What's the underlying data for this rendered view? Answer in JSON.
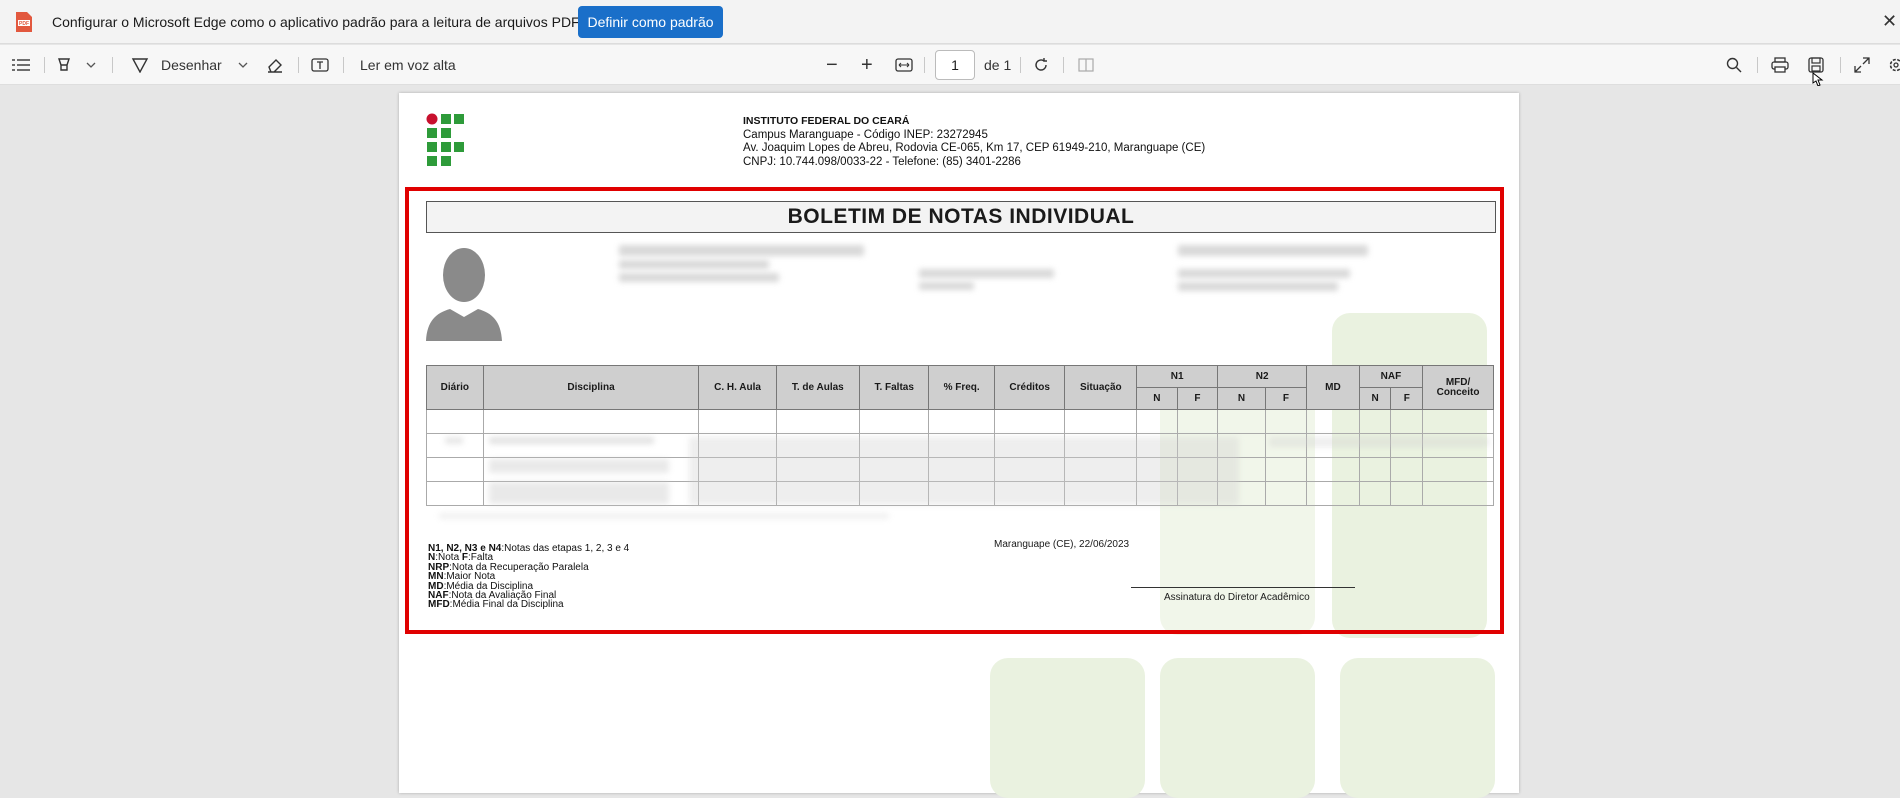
{
  "notification": {
    "message": "Configurar o Microsoft Edge como o aplicativo padrão para a leitura de arquivos PDF?",
    "button_label": "Definir como padrão",
    "close_glyph": "✕"
  },
  "toolbar": {
    "draw_label": "Desenhar",
    "read_aloud_label": "Ler em voz alta",
    "zoom_out": "−",
    "zoom_in": "+",
    "page_number": "1",
    "page_total": "de 1"
  },
  "document": {
    "header": {
      "institution": "INSTITUTO FEDERAL DO CEARÁ",
      "campus": "Campus Maranguape - Código INEP: 23272945",
      "address": "Av. Joaquim Lopes de Abreu, Rodovia CE-065, Km 17, CEP 61949-210, Maranguape (CE)",
      "cnpj": "CNPJ: 10.744.098/0033-22 - Telefone: (85) 3401-2286"
    },
    "title": "BOLETIM DE NOTAS INDIVIDUAL",
    "table": {
      "headers": [
        "Diário",
        "Disciplina",
        "C. H. Aula",
        "T. de Aulas",
        "T. Faltas",
        "% Freq.",
        "Créditos",
        "Situação",
        "N1",
        "N2",
        "MD",
        "NAF",
        "MFD/ Conceito"
      ],
      "sub_n": "N",
      "sub_f": "F"
    },
    "legend": {
      "line1_bold": "N1, N2, N3 e N4",
      "line1_text": ":Notas das etapas 1, 2, 3 e 4",
      "line2_bold1": "N",
      "line2_text1": ":Nota ",
      "line2_bold2": "F",
      "line2_text2": ":Falta",
      "line3_bold": "NRP",
      "line3_text": ":Nota da Recuperação Paralela",
      "line4_bold": "MN",
      "line4_text": ":Maior Nota",
      "line5_bold": "MD",
      "line5_text": ":Média da Disciplina",
      "line6_bold": "NAF",
      "line6_text": ":Nota da Avaliação Final",
      "line7_bold": "MFD",
      "line7_text": ":Média Final da Disciplina"
    },
    "place_date": "Maranguape (CE), 22/06/2023",
    "signature_label": "Assinatura do Diretor Acadêmico"
  },
  "colors": {
    "accent_button": "#1a6fc9",
    "highlight_border": "#e00000",
    "ifce_green": "#2e9b3a",
    "ifce_red": "#c8102e"
  }
}
